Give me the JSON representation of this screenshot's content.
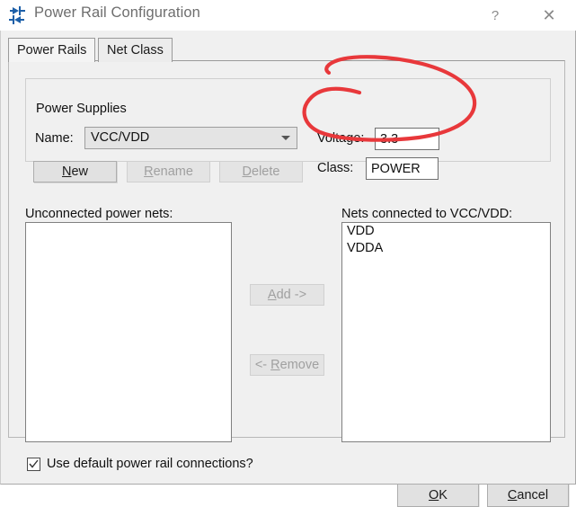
{
  "window": {
    "title": "Power Rail Configuration",
    "icon": "power-rail-icon",
    "help_label": "?",
    "close_label": "✕"
  },
  "tabs": [
    {
      "label": "Power Rails",
      "active": true
    },
    {
      "label": "Net Class",
      "active": false
    }
  ],
  "power_supplies": {
    "group_title": "Power Supplies",
    "name_label": "Name:",
    "name_value": "VCC/VDD",
    "voltage_label": "Voltage:",
    "voltage_value": "3.3",
    "class_label": "Class:",
    "class_value": "POWER",
    "buttons": [
      {
        "label": "New",
        "accel": "N",
        "disabled": false
      },
      {
        "label": "Rename",
        "accel": "R",
        "disabled": true
      },
      {
        "label": "Delete",
        "accel": "D",
        "disabled": true
      }
    ]
  },
  "nets": {
    "unconnected_label": "Unconnected power nets:",
    "unconnected_items": [],
    "connected_label": "Nets connected to VCC/VDD:",
    "connected_items": [
      "VDD",
      "VDDA"
    ],
    "add_label_pre": "A",
    "add_label_post": "dd ->",
    "remove_label_pre": "<- ",
    "remove_label_accel": "R",
    "remove_label_post": "emove"
  },
  "options": {
    "use_default_label": "Use default power rail connections?",
    "use_default_checked": true
  },
  "footer": {
    "ok_label_accel": "O",
    "ok_label_rest": "K",
    "cancel_label_accel": "C",
    "cancel_label_rest": "ancel"
  },
  "annotation": {
    "type": "hand-drawn-ellipse",
    "color": "#e8383b",
    "target": "voltage-field"
  }
}
